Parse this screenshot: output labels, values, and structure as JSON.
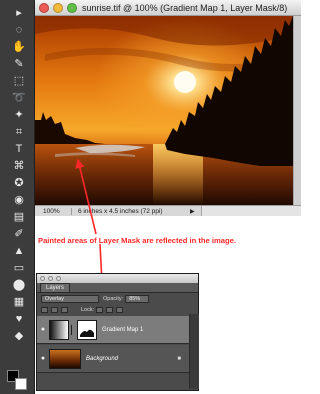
{
  "document": {
    "title": "sunrise.tif @ 100% (Gradient Map 1, Layer Mask/8)",
    "zoom": "100%",
    "info": "6 inches x 4.5 inches (72 ppi)"
  },
  "annotation": {
    "text": "Painted areas of Layer Mask are reflected in the image."
  },
  "layers_panel": {
    "tab": "Layers",
    "blend_mode": "Overlay",
    "opacity_label": "Opacity:",
    "opacity_value": "85%",
    "lock_label": "Lock:",
    "layers": [
      {
        "name": "Gradient Map 1",
        "selected": true
      },
      {
        "name": "Background",
        "selected": false
      }
    ]
  },
  "toolbox": {
    "tools": [
      "move-icon",
      "quick-selection-icon",
      "hand-icon",
      "eyedropper-icon",
      "marquee-icon",
      "lasso-icon",
      "magic-wand-icon",
      "crop-icon",
      "text-icon",
      "pen-icon",
      "shape-icon",
      "zoom-icon",
      "brush-icon",
      "eraser-icon",
      "gradient-icon",
      "blur-icon",
      "dodge-icon",
      "stamp-icon",
      "history-brush-icon",
      "paint-bucket-icon"
    ],
    "foreground_color": "#000000",
    "background_color": "#ffffff"
  },
  "colors": {
    "accent_red": "#ff2828"
  }
}
